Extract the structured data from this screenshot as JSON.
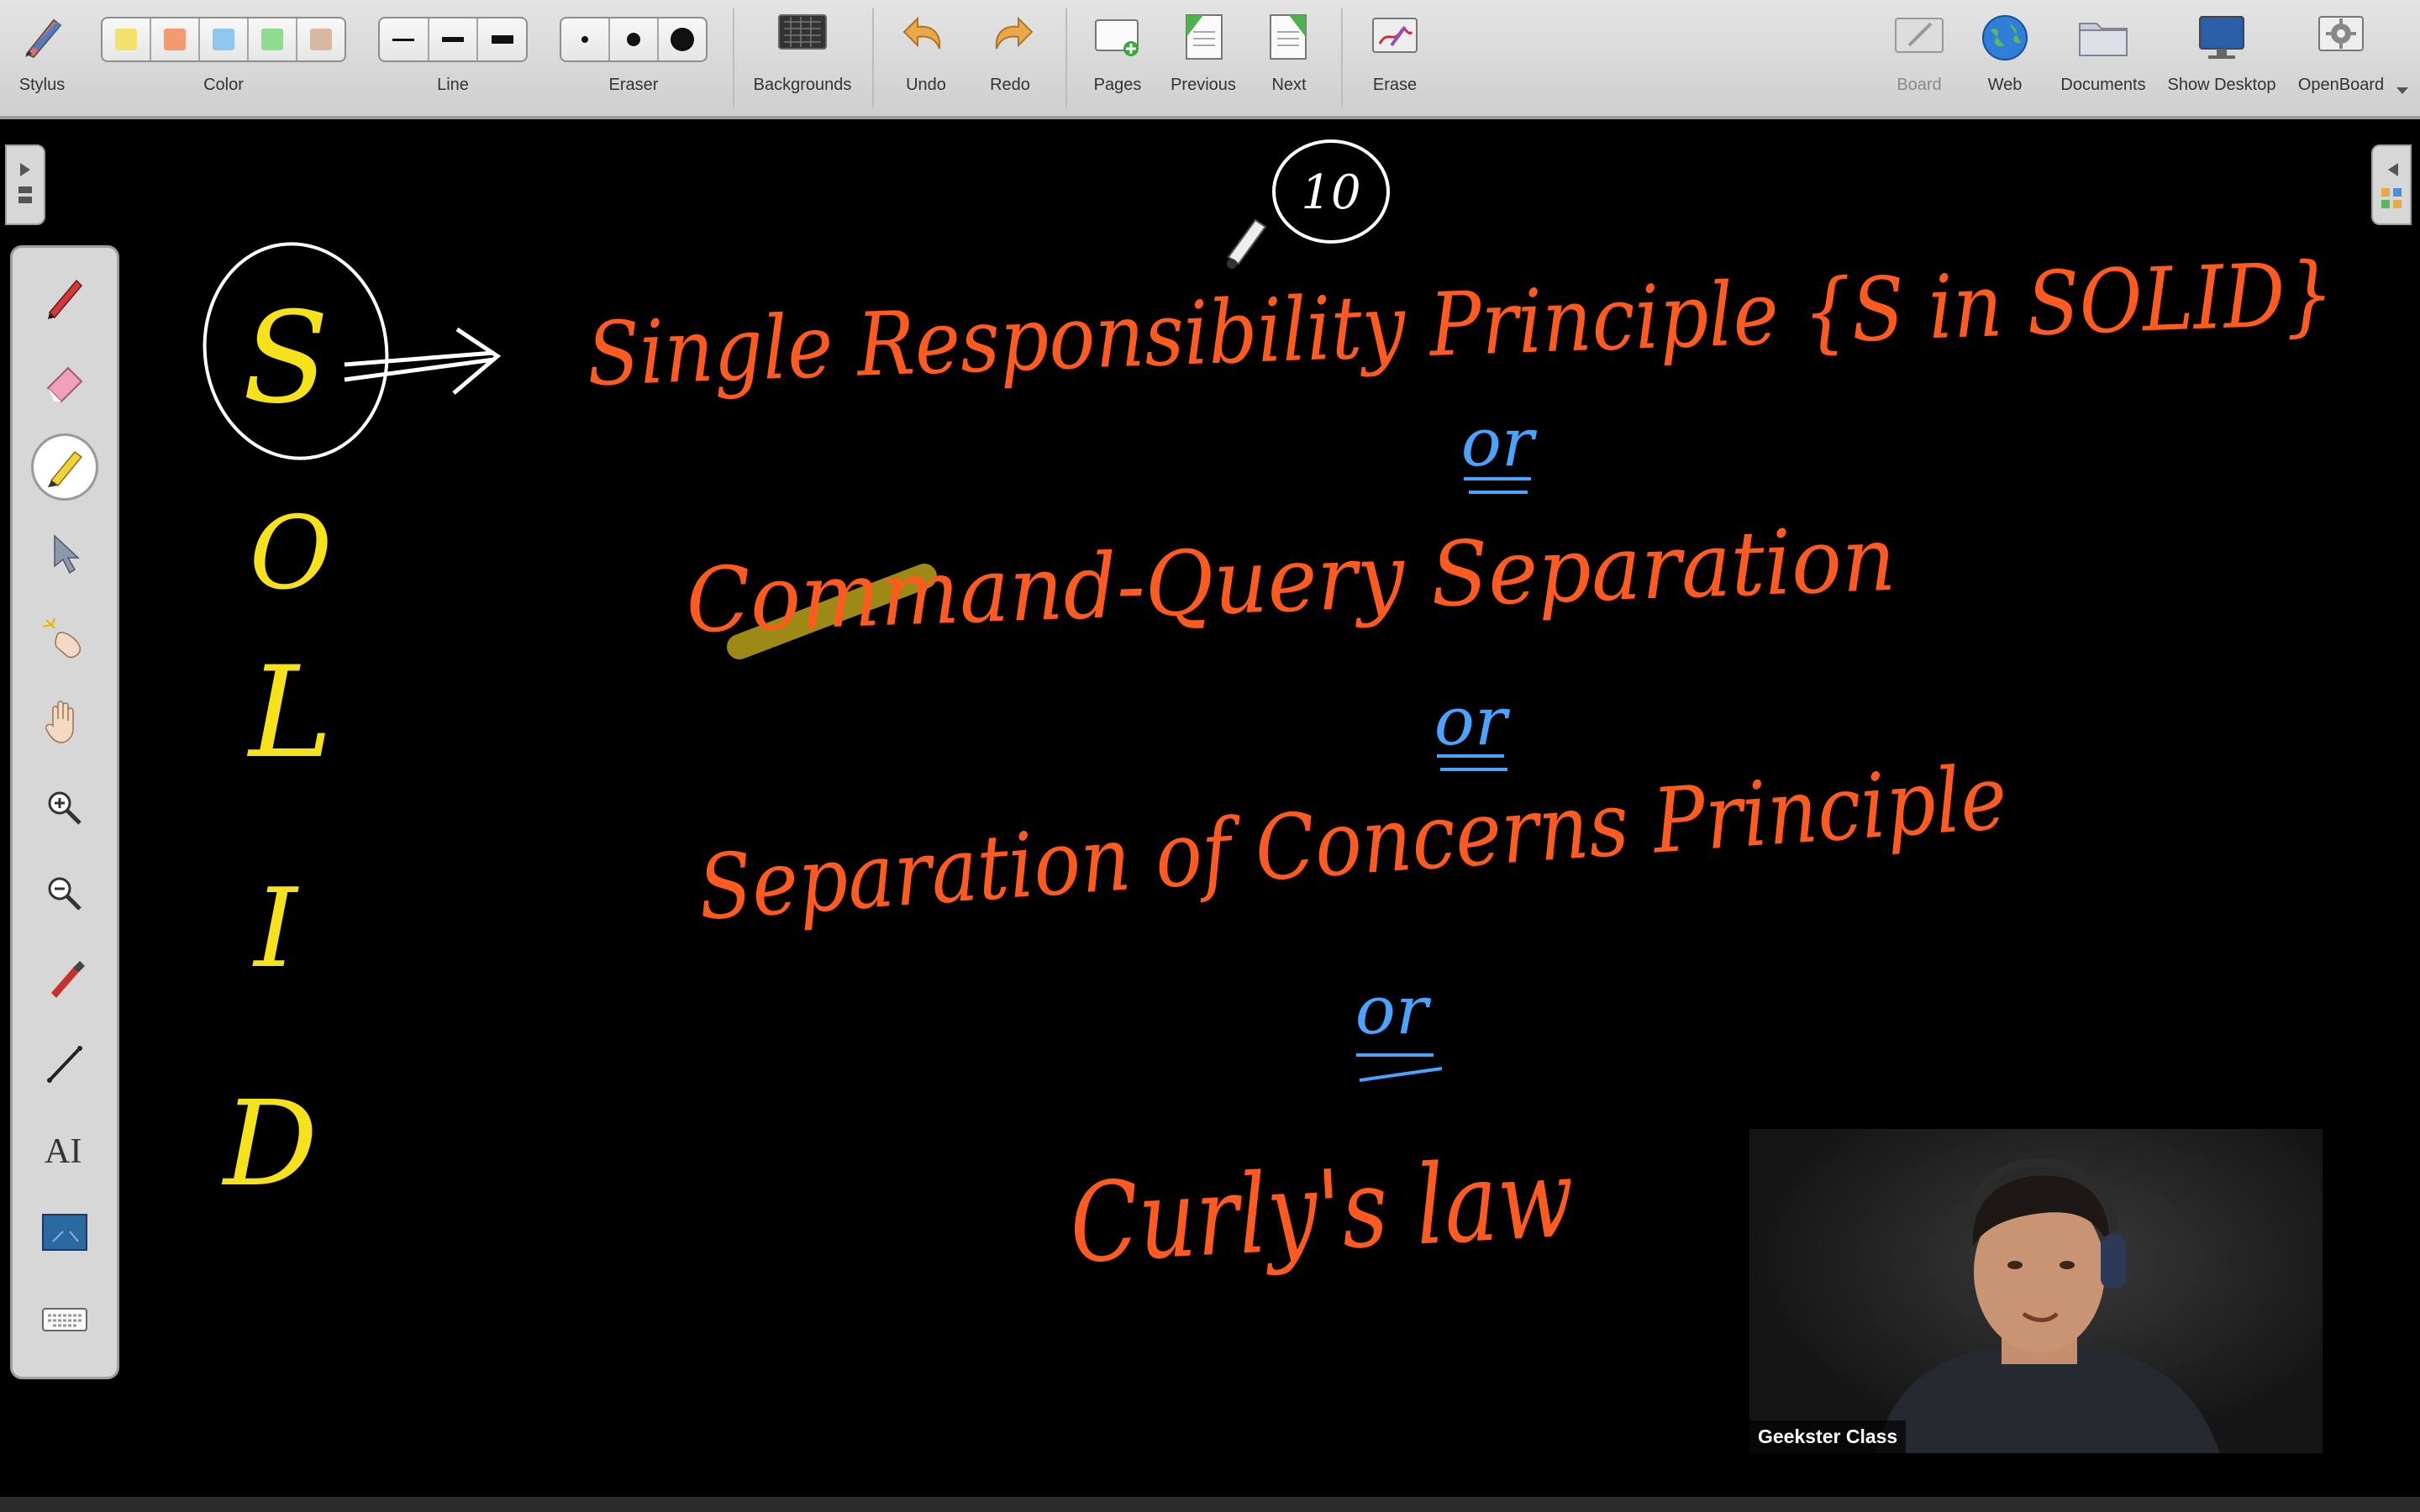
{
  "toolbar": {
    "stylus_label": "Stylus",
    "color_label": "Color",
    "line_label": "Line",
    "eraser_label": "Eraser",
    "backgrounds_label": "Backgrounds",
    "undo_label": "Undo",
    "redo_label": "Redo",
    "pages_label": "Pages",
    "previous_label": "Previous",
    "next_label": "Next",
    "erase_label": "Erase",
    "board_label": "Board",
    "web_label": "Web",
    "documents_label": "Documents",
    "show_desktop_label": "Show Desktop",
    "openboard_label": "OpenBoard",
    "colors": [
      "#f3e36a",
      "#f39a6e",
      "#8ec8ee",
      "#8edc8e",
      "#d8b8a0"
    ]
  },
  "left_panel": {
    "tools": [
      "pen-icon",
      "eraser-icon",
      "marker-icon",
      "selector-icon",
      "laser-pointer-icon",
      "hand-icon",
      "zoom-in-icon",
      "zoom-out-icon",
      "capture-icon",
      "line-icon",
      "text-icon",
      "screen-capture-icon",
      "keyboard-icon"
    ],
    "active_tool": "marker-icon"
  },
  "board": {
    "page_number": "10",
    "solid_letters": [
      "S",
      "O",
      "L",
      "I",
      "D"
    ],
    "lines": [
      "Single Responsibility Principle {S in SOLID}",
      "or",
      "Command-Query Separation",
      "or",
      "Separation of Concerns Principle",
      "or",
      "Curly's law"
    ],
    "colors": {
      "primary_ink": "#ff5a1f",
      "solid_ink": "#f5e21a",
      "or_ink": "#4aa3ff",
      "highlight": "#b9a21a"
    }
  },
  "video": {
    "participant_name": "Geekster Class"
  }
}
